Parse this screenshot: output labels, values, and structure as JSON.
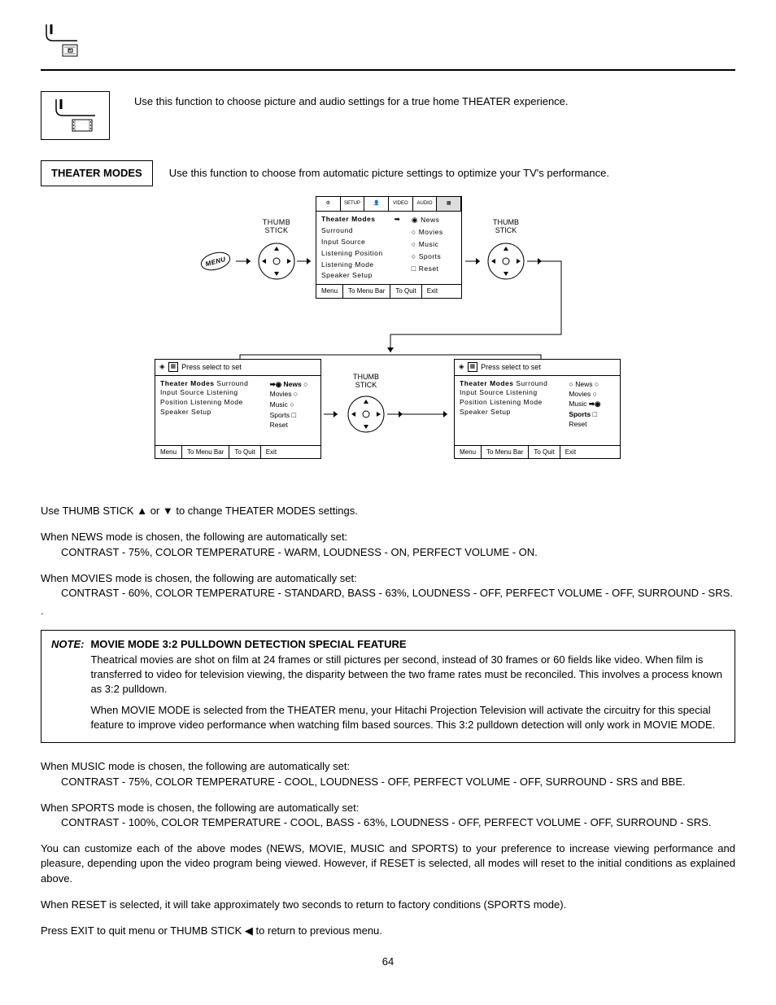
{
  "intro": "Use this function to choose picture and audio settings for a true home THEATER experience.",
  "section_label": "THEATER MODES",
  "section_desc": "Use this function to choose from automatic picture settings to optimize your TV's performance.",
  "thumbstick_label": "THUMB\nSTICK",
  "menu_tag": "MENU",
  "menu1": {
    "left": [
      "Theater Modes",
      "Surround",
      "Input Source",
      "Listening Position",
      "Listening Mode",
      "Speaker Setup"
    ],
    "right": [
      "News",
      "Movies",
      "Music",
      "Sports",
      "Reset"
    ],
    "footer": [
      "Menu",
      "To Menu Bar",
      "To Quit",
      "Exit"
    ]
  },
  "press_select": "Press select to set",
  "menu2": {
    "left": [
      "Theater Modes",
      "Surround",
      "Input Source",
      "Listening Position",
      "Listening Mode",
      "Speaker Setup"
    ],
    "right_news_sel": "News",
    "right": [
      "Movies",
      "Music",
      "Sports",
      "Reset"
    ],
    "footer": [
      "Menu",
      "To Menu Bar",
      "To Quit",
      "Exit"
    ]
  },
  "menu3": {
    "left": [
      "Theater Modes",
      "Surround",
      "Input Source",
      "Listening Position",
      "Listening Mode",
      "Speaker Setup"
    ],
    "right_top": [
      "News",
      "Movies",
      "Music"
    ],
    "right_sports_sel": "Sports",
    "right_bot": [
      "Reset"
    ],
    "footer": [
      "Menu",
      "To Menu Bar",
      "To Quit",
      "Exit"
    ]
  },
  "p_use_thumbstick": "Use THUMB STICK ▲ or ▼ to change THEATER MODES settings.",
  "p_news_1": "When NEWS mode is chosen, the following are automatically set:",
  "p_news_2": "CONTRAST - 75%, COLOR TEMPERATURE - WARM, LOUDNESS - ON, PERFECT VOLUME - ON.",
  "p_movies_1": "When MOVIES mode is chosen, the following are automatically set:",
  "p_movies_2": "CONTRAST - 60%, COLOR TEMPERATURE - STANDARD, BASS - 63%, LOUDNESS - OFF, PERFECT VOLUME - OFF, SURROUND - SRS.",
  "dot": ".",
  "note_label": "NOTE:",
  "note_title": "MOVIE MODE 3:2 PULLDOWN DETECTION SPECIAL FEATURE",
  "note_p1": "Theatrical movies are shot on film at 24 frames or still pictures per second, instead of 30 frames or 60 fields like video.  When film is transferred to video for television viewing, the disparity between the two frame rates must be reconciled.  This involves a process known as 3:2 pulldown.",
  "note_p2": "When MOVIE MODE is selected from the THEATER menu, your Hitachi Projection Television will activate the circuitry for this special feature to improve video performance when watching film based sources.  This 3:2 pulldown detection will only work in MOVIE MODE.",
  "p_music_1": "When MUSIC mode is chosen, the following are automatically set:",
  "p_music_2": "CONTRAST - 75%, COLOR TEMPERATURE - COOL, LOUDNESS - OFF, PERFECT VOLUME - OFF, SURROUND - SRS and BBE.",
  "p_sports_1": "When SPORTS mode is chosen, the following are automatically set:",
  "p_sports_2": "CONTRAST - 100%, COLOR TEMPERATURE - COOL, BASS - 63%, LOUDNESS - OFF, PERFECT VOLUME - OFF, SURROUND - SRS.",
  "p_customize": "You can customize each of the above modes (NEWS, MOVIE, MUSIC and SPORTS) to your preference to increase viewing performance and pleasure, depending upon the video program being viewed. However, if RESET is selected, all modes will reset to the initial conditions as explained above.",
  "p_reset": "When RESET is selected, it will take approximately two seconds to return to factory conditions (SPORTS mode).",
  "p_exit": "Press EXIT to quit menu or THUMB STICK ◀ to return to previous menu.",
  "page_number": "64"
}
